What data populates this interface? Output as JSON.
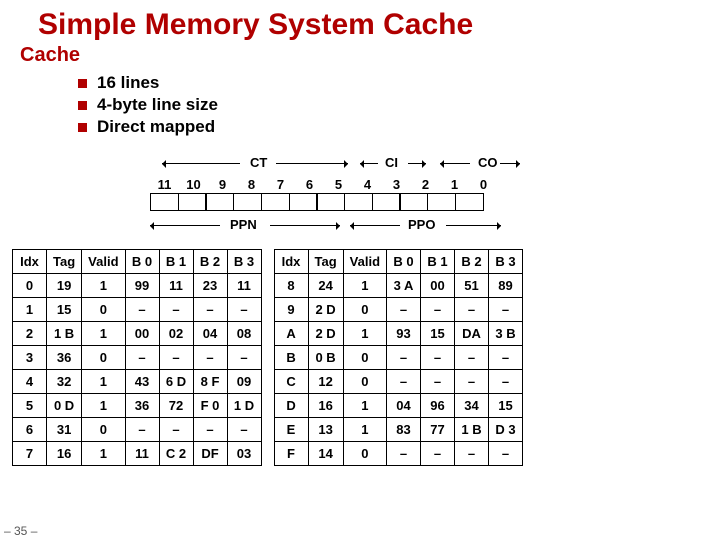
{
  "title": "Simple Memory System Cache",
  "sub": "Cache",
  "bullets": [
    "16 lines",
    "4-byte line size",
    "Direct mapped"
  ],
  "bitdiagram": {
    "ct": "CT",
    "ci": "CI",
    "co": "CO",
    "ppn": "PPN",
    "ppo": "PPO",
    "bits": [
      "11",
      "10",
      "9",
      "8",
      "7",
      "6",
      "5",
      "4",
      "3",
      "2",
      "1",
      "0"
    ]
  },
  "headers": [
    "Idx",
    "Tag",
    "Valid",
    "B 0",
    "B 1",
    "B 2",
    "B 3"
  ],
  "left": [
    [
      "0",
      "19",
      "1",
      "99",
      "11",
      "23",
      "11"
    ],
    [
      "1",
      "15",
      "0",
      "–",
      "–",
      "–",
      "–"
    ],
    [
      "2",
      "1 B",
      "1",
      "00",
      "02",
      "04",
      "08"
    ],
    [
      "3",
      "36",
      "0",
      "–",
      "–",
      "–",
      "–"
    ],
    [
      "4",
      "32",
      "1",
      "43",
      "6 D",
      "8 F",
      "09"
    ],
    [
      "5",
      "0 D",
      "1",
      "36",
      "72",
      "F 0",
      "1 D"
    ],
    [
      "6",
      "31",
      "0",
      "–",
      "–",
      "–",
      "–"
    ],
    [
      "7",
      "16",
      "1",
      "11",
      "C 2",
      "DF",
      "03"
    ]
  ],
  "right": [
    [
      "8",
      "24",
      "1",
      "3 A",
      "00",
      "51",
      "89"
    ],
    [
      "9",
      "2 D",
      "0",
      "–",
      "–",
      "–",
      "–"
    ],
    [
      "A",
      "2 D",
      "1",
      "93",
      "15",
      "DA",
      "3 B"
    ],
    [
      "B",
      "0 B",
      "0",
      "–",
      "–",
      "–",
      "–"
    ],
    [
      "C",
      "12",
      "0",
      "–",
      "–",
      "–",
      "–"
    ],
    [
      "D",
      "16",
      "1",
      "04",
      "96",
      "34",
      "15"
    ],
    [
      "E",
      "13",
      "1",
      "83",
      "77",
      "1 B",
      "D 3"
    ],
    [
      "F",
      "14",
      "0",
      "–",
      "–",
      "–",
      "–"
    ]
  ],
  "pagefoot": "– 35 –"
}
